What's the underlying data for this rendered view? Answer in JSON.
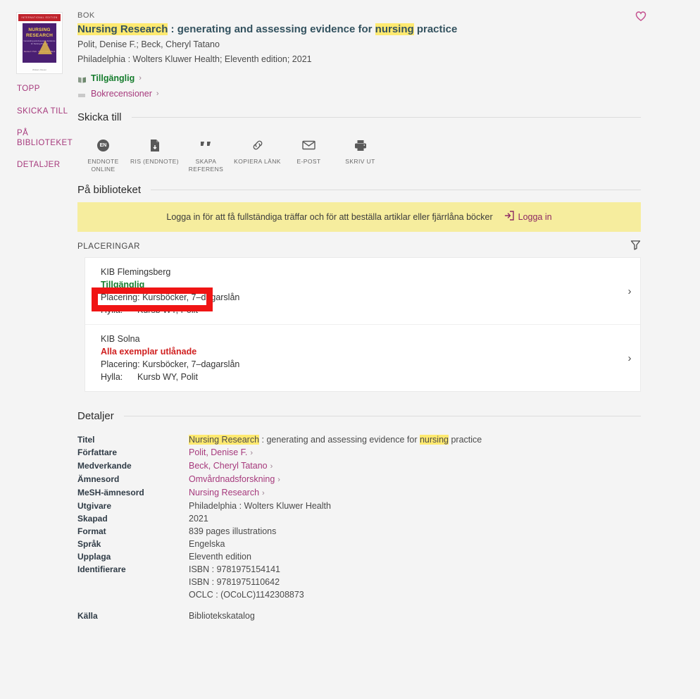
{
  "rail": {
    "items": [
      {
        "label": "TOPP",
        "name": "sidebar-item-topp"
      },
      {
        "label": "SKICKA TILL",
        "name": "sidebar-item-skicka-till"
      },
      {
        "label": "PÅ BIBLIOTEKET",
        "name": "sidebar-item-pa-biblioteket"
      },
      {
        "label": "DETALJER",
        "name": "sidebar-item-detaljer"
      }
    ]
  },
  "cover": {
    "band": "INTERNATIONAL EDITION",
    "title": "NURSING RESEARCH",
    "subtitle": "Generating and Assessing Evidence for Nursing Practice",
    "authors": "Denise F. Polit · Cheryl Tatano Beck",
    "publisher": "Wolters Kluwer"
  },
  "record": {
    "type": "BOK",
    "title_hl1": "Nursing Research",
    "title_mid": " : generating and assessing evidence for ",
    "title_hl2": "nursing",
    "title_end": " practice",
    "authors": "Polit, Denise F.; Beck, Cheryl Tatano",
    "imprint": "Philadelphia : Wolters Kluwer Health; Eleventh edition; 2021",
    "availability": "Tillgänglig",
    "reviews": "Bokrecensioner",
    "chevron": "›",
    "favorite_icon": "heart-icon"
  },
  "send_to": {
    "heading": "Skicka till",
    "actions": [
      {
        "label": "ENDNOTE ONLINE",
        "icon": "endnote-online-icon",
        "name": "send-to-endnote-online"
      },
      {
        "label": "RIS (ENDNOTE)",
        "icon": "ris-file-icon",
        "name": "send-to-ris"
      },
      {
        "label": "SKAPA REFERENS",
        "icon": "quote-icon",
        "name": "send-to-citation"
      },
      {
        "label": "KOPIERA LÄNK",
        "icon": "link-icon",
        "name": "send-to-copy-link"
      },
      {
        "label": "E-POST",
        "icon": "envelope-icon",
        "name": "send-to-email"
      },
      {
        "label": "SKRIV UT",
        "icon": "printer-icon",
        "name": "send-to-print"
      }
    ]
  },
  "library": {
    "heading": "På biblioteket",
    "banner_text": "Logga in för att få fullständiga träffar och för att beställa artiklar eller fjärrlåna böcker",
    "banner_button": "Logga in",
    "placements_label": "PLACERINGAR",
    "filter_icon": "filter-funnel-icon",
    "rows": [
      {
        "library": "KIB Flemingsberg",
        "status": "Tillgänglig",
        "status_kind": "ok",
        "placement_key": "Placering:",
        "placement_value": "Kursböcker, 7–dagarslån",
        "shelf_key": "Hylla:",
        "shelf_value": "Kursb WY, Polit",
        "arrow": "›"
      },
      {
        "library": "KIB Solna",
        "status": "Alla exemplar utlånade",
        "status_kind": "no",
        "placement_key": "Placering:",
        "placement_value": "Kursböcker, 7–dagarslån",
        "shelf_key": "Hylla:",
        "shelf_value": "Kursb WY, Polit",
        "arrow": "›"
      }
    ]
  },
  "details": {
    "heading": "Detaljer",
    "title_label": "Titel",
    "title_hl1": "Nursing Research",
    "title_mid": " : generating and assessing evidence for ",
    "title_hl2": "nursing",
    "title_end": " practice",
    "rows": [
      {
        "key": "Författare",
        "value": "Polit, Denise F.",
        "link": true,
        "arrow": "›"
      },
      {
        "key": "Medverkande",
        "value": "Beck, Cheryl Tatano",
        "link": true,
        "arrow": "›"
      },
      {
        "key": "Ämnesord",
        "value": "Omvårdnadsforskning",
        "link": true,
        "arrow": "›"
      },
      {
        "key": "MeSH-ämnesord",
        "value": "Nursing Research",
        "link": true,
        "arrow": "›"
      },
      {
        "key": "Utgivare",
        "value": "Philadelphia : Wolters Kluwer Health",
        "link": false
      },
      {
        "key": "Skapad",
        "value": "2021",
        "link": false
      },
      {
        "key": "Format",
        "value": "839 pages illustrations",
        "link": false
      },
      {
        "key": "Språk",
        "value": "Engelska",
        "link": false
      },
      {
        "key": "Upplaga",
        "value": "Eleventh edition",
        "link": false
      }
    ],
    "identifier_key": "Identifierare",
    "identifiers": [
      "ISBN : 9781975154141",
      "ISBN : 9781975110642",
      "OCLC : (OCoLC)1142308873"
    ],
    "source_key": "Källa",
    "source_value": "Bibliotekskatalog"
  },
  "annotation": {
    "name": "red-highlight-box",
    "color": "#f01414"
  },
  "colors": {
    "accent_magenta": "#a6397c",
    "title_slate": "#33525f",
    "highlight_yellow": "#ffe970",
    "available_green": "#157c2d",
    "loaned_red": "#d02020",
    "banner_yellow": "#f6ed9e",
    "page_bg": "#f4f4f4"
  }
}
